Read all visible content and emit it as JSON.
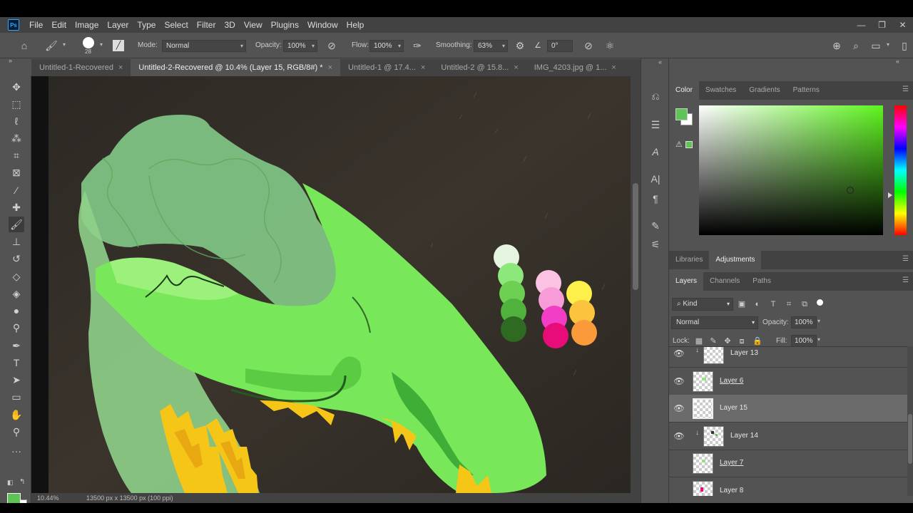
{
  "app": {
    "logo": "Ps",
    "menu": [
      "File",
      "Edit",
      "Image",
      "Layer",
      "Type",
      "Select",
      "Filter",
      "3D",
      "View",
      "Plugins",
      "Window",
      "Help"
    ],
    "window_controls": {
      "minimize": "—",
      "restore": "❐",
      "close": "✕"
    }
  },
  "options": {
    "brush_size": "28",
    "mode_label": "Mode:",
    "mode_value": "Normal",
    "opacity_label": "Opacity:",
    "opacity_value": "100%",
    "flow_label": "Flow:",
    "flow_value": "100%",
    "smoothing_label": "Smoothing:",
    "smoothing_value": "63%",
    "angle_value": "0°"
  },
  "tabs": [
    {
      "label": "Untitled-1-Recovered",
      "active": false
    },
    {
      "label": "Untitled-2-Recovered @ 10.4% (Layer 15, RGB/8#) *",
      "active": true
    },
    {
      "label": "Untitled-1 @ 17.4...",
      "active": false
    },
    {
      "label": "Untitled-2 @ 15.8...",
      "active": false
    },
    {
      "label": "IMG_4203.jpg @ 1...",
      "active": false
    }
  ],
  "status": {
    "zoom": "10.44%",
    "doc_size": "13500 px x 13500 px (100 ppi)"
  },
  "colors": {
    "foreground": "#5fc456",
    "background": "#ffffff",
    "picker_hue": "#5ef41f"
  },
  "color_panel": {
    "tabs": [
      "Color",
      "Swatches",
      "Gradients",
      "Patterns"
    ],
    "active": "Color"
  },
  "adjust_panel": {
    "tabs": [
      "Libraries",
      "Adjustments"
    ],
    "active": "Adjustments"
  },
  "layers_panel": {
    "tabs": [
      "Layers",
      "Channels",
      "Paths"
    ],
    "active": "Layers",
    "kind_label": "Kind",
    "blend_mode": "Normal",
    "opacity_label": "Opacity:",
    "opacity_value": "100%",
    "lock_label": "Lock:",
    "fill_label": "Fill:",
    "fill_value": "100%",
    "layers": [
      {
        "name": "Layer 13",
        "visible": true,
        "clipped": true,
        "selected": false,
        "underlined": false
      },
      {
        "name": "Layer 6",
        "visible": true,
        "clipped": false,
        "selected": false,
        "underlined": true
      },
      {
        "name": "Layer 15",
        "visible": true,
        "clipped": false,
        "selected": true,
        "underlined": false
      },
      {
        "name": "Layer 14",
        "visible": true,
        "clipped": true,
        "selected": false,
        "underlined": false
      },
      {
        "name": "Layer 7",
        "visible": false,
        "clipped": false,
        "selected": false,
        "underlined": true
      },
      {
        "name": "Layer 8",
        "visible": false,
        "clipped": false,
        "selected": false,
        "underlined": false
      }
    ]
  }
}
